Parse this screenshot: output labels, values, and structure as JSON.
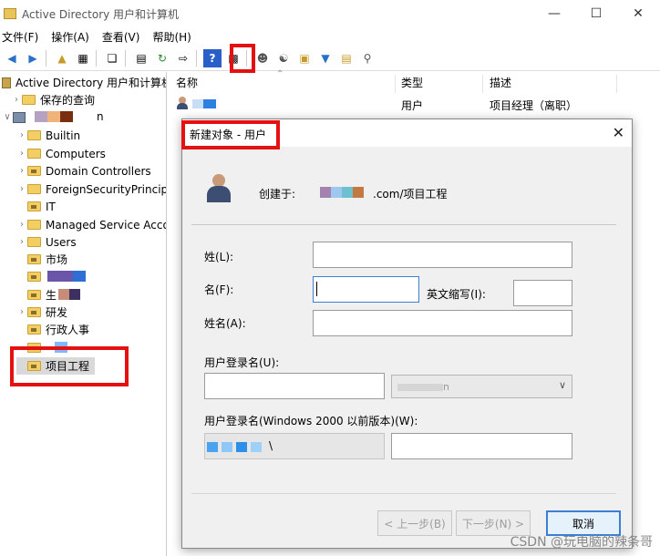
{
  "window": {
    "title": "Active Directory 用户和计算机"
  },
  "menu": [
    "文件(F)",
    "操作(A)",
    "查看(V)",
    "帮助(H)"
  ],
  "tree": {
    "root": "Active Directory 用户和计算机",
    "saved_queries": "保存的查询",
    "domain_suffix": "n",
    "items": [
      "Builtin",
      "Computers",
      "Domain Controllers",
      "ForeignSecurityPrincipa",
      "IT",
      "Managed Service Acco",
      "Users",
      "市场",
      "生",
      "研发",
      "行政人事",
      "项目工程"
    ]
  },
  "list": {
    "columns": [
      "名称",
      "类型",
      "描述"
    ],
    "row": {
      "type": "用户",
      "desc": "项目经理（离职）"
    }
  },
  "dialog": {
    "title": "新建对象 - 用户",
    "created_in_label": "创建于:",
    "created_in_value": ".com/项目工程",
    "last_name_label": "姓(L):",
    "first_name_label": "名(F):",
    "initials_label": "英文缩写(I):",
    "full_name_label": "姓名(A):",
    "logon_label": "用户登录名(U):",
    "logon_domain_value": "n",
    "logon_pre2000_label": "用户登录名(Windows 2000 以前版本)(W):",
    "logon_pre2000_domain": "\\",
    "back_button": "< 上一步(B)",
    "next_button": "下一步(N) >",
    "cancel_button": "取消"
  },
  "watermark": "CSDN @玩电脑的辣条哥",
  "colors": {
    "highlight": "#e51010",
    "accent": "#3c7fd6",
    "folder": "#f3cf63"
  }
}
